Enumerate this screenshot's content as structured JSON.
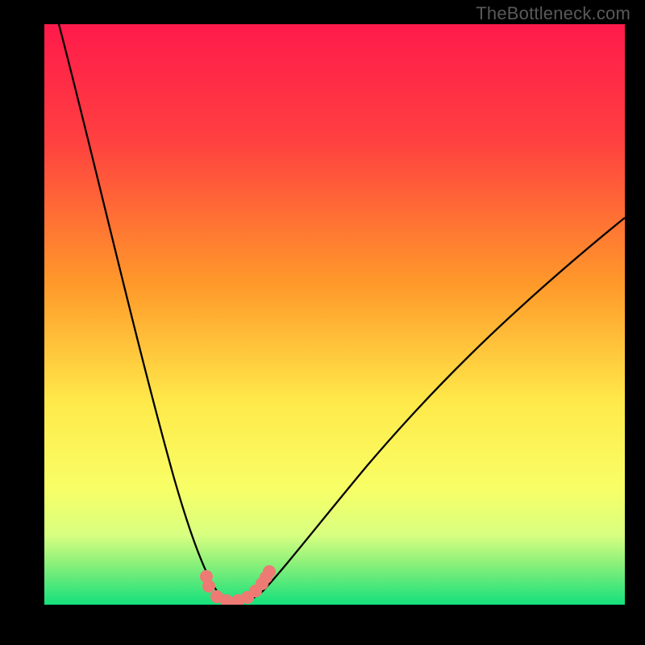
{
  "watermark": {
    "text": "TheBottleneck.com"
  },
  "chart_data": {
    "type": "line",
    "title": "",
    "xlabel": "",
    "ylabel": "",
    "xlim": [
      0,
      100
    ],
    "ylim": [
      0,
      100
    ],
    "grid": false,
    "legend": false,
    "background_gradient": {
      "stops": [
        {
          "pct": 0,
          "color": "#ff1a4b"
        },
        {
          "pct": 20,
          "color": "#ff4040"
        },
        {
          "pct": 45,
          "color": "#ff9a2a"
        },
        {
          "pct": 65,
          "color": "#ffe94a"
        },
        {
          "pct": 80,
          "color": "#f8ff66"
        },
        {
          "pct": 88,
          "color": "#d8ff80"
        },
        {
          "pct": 93,
          "color": "#8af07a"
        },
        {
          "pct": 100,
          "color": "#14e07c"
        }
      ]
    },
    "series": [
      {
        "name": "bottleneck-curve",
        "color": "#000000",
        "x": [
          0,
          3,
          6,
          10,
          14,
          18,
          22,
          25,
          27,
          29,
          31,
          33,
          35,
          38,
          42,
          48,
          55,
          63,
          72,
          82,
          92,
          100
        ],
        "y": [
          100,
          88,
          76,
          63,
          50,
          38,
          27,
          18,
          11,
          6,
          2,
          0,
          2,
          6,
          12,
          20,
          29,
          38,
          47,
          55,
          62,
          67
        ]
      },
      {
        "name": "marker-dots",
        "type": "scatter",
        "color": "#ee7a74",
        "x": [
          27.5,
          28.0,
          29.5,
          31.0,
          33.0,
          34.5,
          36.0,
          37.0,
          37.5,
          38.0
        ],
        "y": [
          4.2,
          3.0,
          1.2,
          0.6,
          0.6,
          1.2,
          2.2,
          3.2,
          4.2,
          5.0
        ]
      }
    ]
  }
}
